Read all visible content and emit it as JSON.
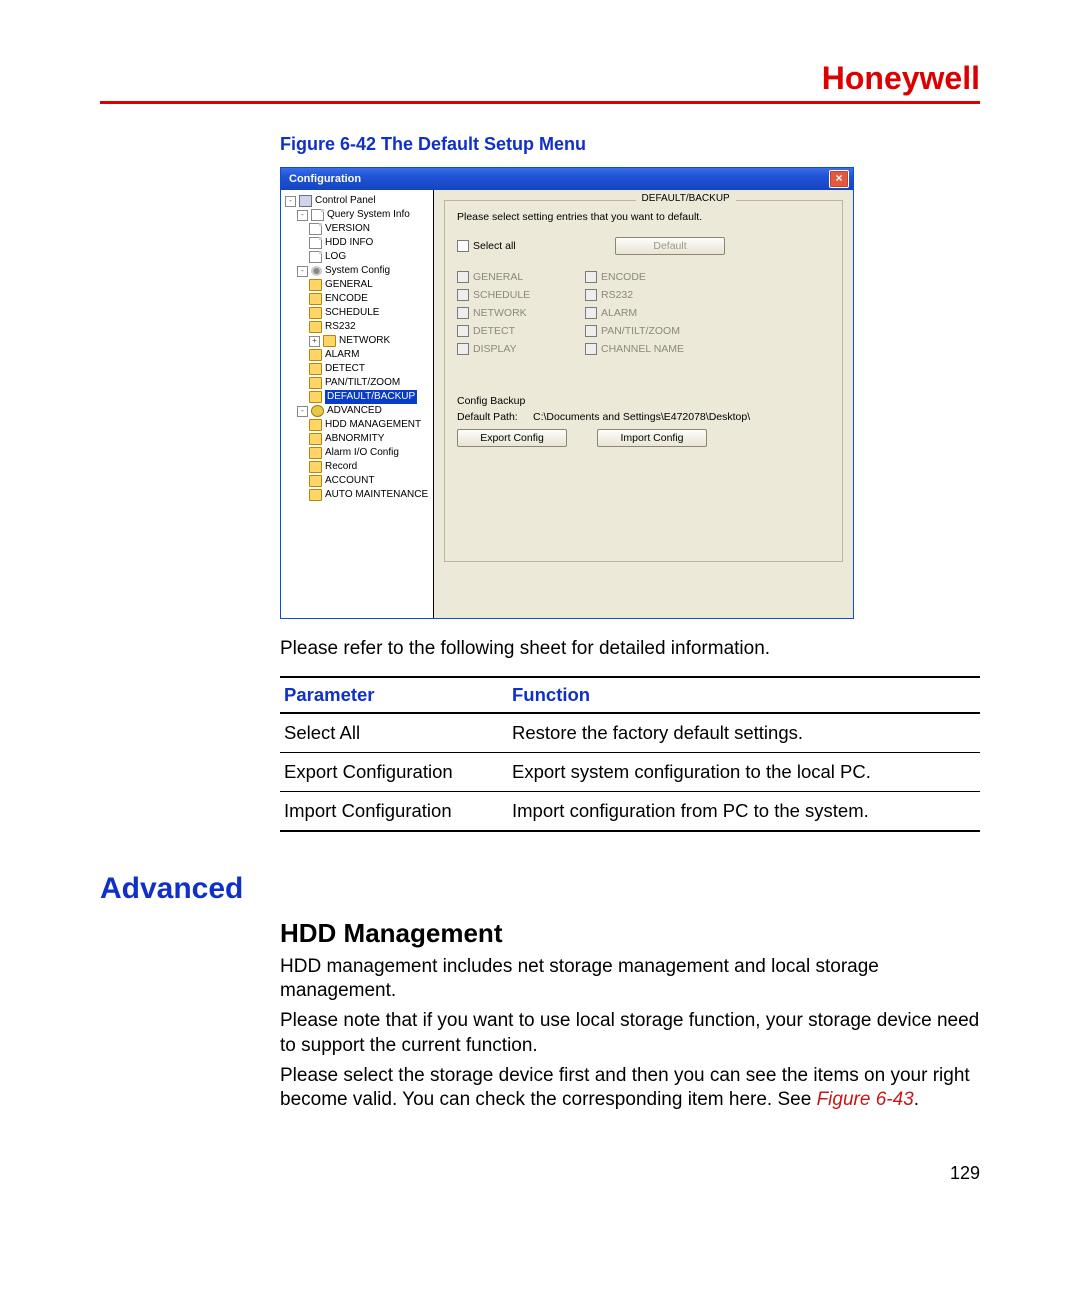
{
  "brand": "Honeywell",
  "figure_caption": "Figure 6-42 The Default Setup Menu",
  "dialog": {
    "title": "Configuration",
    "close_x": "×",
    "tree": {
      "root": "Control Panel",
      "g1": {
        "label": "Query System Info",
        "items": [
          "VERSION",
          "HDD INFO",
          "LOG"
        ]
      },
      "g2": {
        "label": "System Config",
        "items": [
          "GENERAL",
          "ENCODE",
          "SCHEDULE",
          "RS232",
          "NETWORK",
          "ALARM",
          "DETECT",
          "PAN/TILT/ZOOM",
          "DEFAULT/BACKUP"
        ]
      },
      "g3": {
        "label": "ADVANCED",
        "items": [
          "HDD MANAGEMENT",
          "ABNORMITY",
          "Alarm I/O Config",
          "Record",
          "ACCOUNT",
          "AUTO MAINTENANCE"
        ]
      }
    },
    "group_title": "DEFAULT/BACKUP",
    "instruction": "Please select setting entries that you want to default.",
    "select_all": "Select all",
    "default_btn": "Default",
    "options": [
      "GENERAL",
      "ENCODE",
      "SCHEDULE",
      "RS232",
      "NETWORK",
      "ALARM",
      "DETECT",
      "PAN/TILT/ZOOM",
      "DISPLAY",
      "CHANNEL NAME"
    ],
    "config_backup_label": "Config Backup",
    "default_path_label": "Default Path:",
    "default_path_value": "C:\\Documents and Settings\\E472078\\Desktop\\",
    "export_btn": "Export Config",
    "import_btn": "Import Config"
  },
  "intro_text": "Please refer to the following sheet for detailed information.",
  "table": {
    "h1": "Parameter",
    "h2": "Function",
    "rows": [
      {
        "p": "Select All",
        "f": "Restore the factory default settings."
      },
      {
        "p": "Export Configuration",
        "f": "Export system configuration to the local PC."
      },
      {
        "p": "Import Configuration",
        "f": "Import configuration from PC to the system."
      }
    ]
  },
  "section_h1": "Advanced",
  "section_h2": "HDD Management",
  "paragraphs": {
    "p1": "HDD management includes net storage management and local storage management.",
    "p2": "Please note that if you want to use local storage function, your storage device need to support the current function.",
    "p3a": "Please select the storage device first and then you can see the items on your right become valid. You can check the corresponding item here. See ",
    "figref": "Figure 6-43",
    "p3b": "."
  },
  "page_number": "129"
}
